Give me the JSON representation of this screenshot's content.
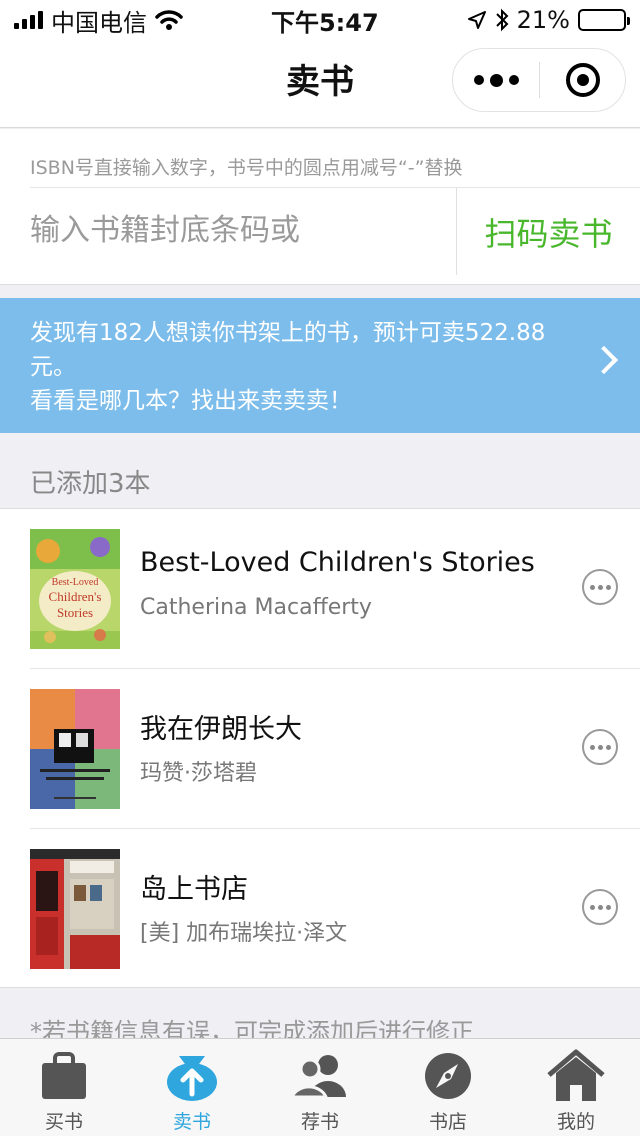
{
  "status_bar": {
    "carrier": "中国电信",
    "time": "下午5:47",
    "battery": "21%",
    "battery_level": 0.21
  },
  "navbar": {
    "title": "卖书"
  },
  "isbn": {
    "hint": "ISBN号直接输入数字，书号中的圆点用减号“-”替换",
    "placeholder": "输入书籍封底条码或",
    "scan_label": "扫码卖书"
  },
  "promo": {
    "line1": "发现有182人想读你书架上的书，预计可卖522.88元。",
    "line2": "看看是哪几本？找出来卖卖卖！"
  },
  "added_count": "已添加3本",
  "books": [
    {
      "title": "Best-Loved Children's Stories",
      "author": "Catherina Macafferty"
    },
    {
      "title": "我在伊朗长大",
      "author": "玛赞·莎塔碧"
    },
    {
      "title": "岛上书店",
      "author": "[美] 加布瑞埃拉·泽文"
    }
  ],
  "footnote": "*若书籍信息有误，可完成添加后进行修正",
  "tabs": [
    {
      "label": "买书",
      "icon": "shopping-bag-icon"
    },
    {
      "label": "卖书",
      "icon": "upload-bag-icon"
    },
    {
      "label": "荐书",
      "icon": "people-icon"
    },
    {
      "label": "书店",
      "icon": "compass-icon"
    },
    {
      "label": "我的",
      "icon": "home-icon"
    }
  ],
  "colors": {
    "accent_green": "#48b72c",
    "promo_blue": "#7cbdeb",
    "active_tab": "#2fa6de"
  }
}
